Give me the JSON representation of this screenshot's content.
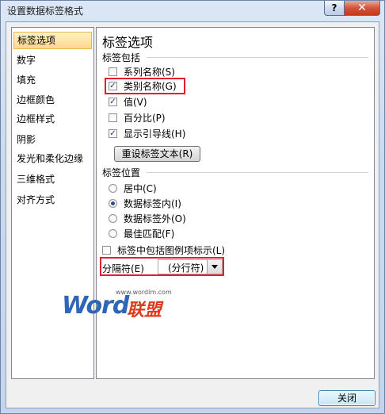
{
  "window": {
    "title": "设置数据标签格式",
    "help_glyph": "?",
    "close_glyph": "✕"
  },
  "sidebar": {
    "items": [
      {
        "label": "标签选项",
        "active": true
      },
      {
        "label": "数字"
      },
      {
        "label": "填充"
      },
      {
        "label": "边框颜色"
      },
      {
        "label": "边框样式"
      },
      {
        "label": "阴影"
      },
      {
        "label": "发光和柔化边缘"
      },
      {
        "label": "三维格式"
      },
      {
        "label": "对齐方式"
      }
    ]
  },
  "panel": {
    "heading": "标签选项",
    "label_contains": {
      "title": "标签包括",
      "options": [
        {
          "label": "系列名称(S)",
          "checked": false
        },
        {
          "label": "类别名称(G)",
          "checked": true,
          "highlighted": true
        },
        {
          "label": "值(V)",
          "checked": true
        },
        {
          "label": "百分比(P)",
          "checked": false
        },
        {
          "label": "显示引导线(H)",
          "checked": true
        }
      ],
      "reset_button": "重设标签文本(R)"
    },
    "label_position": {
      "title": "标签位置",
      "options": [
        {
          "label": "居中(C)",
          "selected": false
        },
        {
          "label": "数据标签内(I)",
          "selected": true
        },
        {
          "label": "数据标签外(O)",
          "selected": false
        },
        {
          "label": "最佳匹配(F)",
          "selected": false
        }
      ]
    },
    "legend_key": {
      "label": "标签中包括图例项标示(L)",
      "checked": false
    },
    "separator": {
      "label": "分隔符(E)",
      "value": "(分行符)"
    }
  },
  "watermark": {
    "word": "Word",
    "cn": "联盟",
    "url": "www.wordlm.com"
  },
  "footer": {
    "close_button": "关闭"
  },
  "colors": {
    "highlight": "#e0202c",
    "selection": "#fcd98b",
    "watermark_blue": "#2f66b5",
    "watermark_red": "#e03a1e"
  }
}
